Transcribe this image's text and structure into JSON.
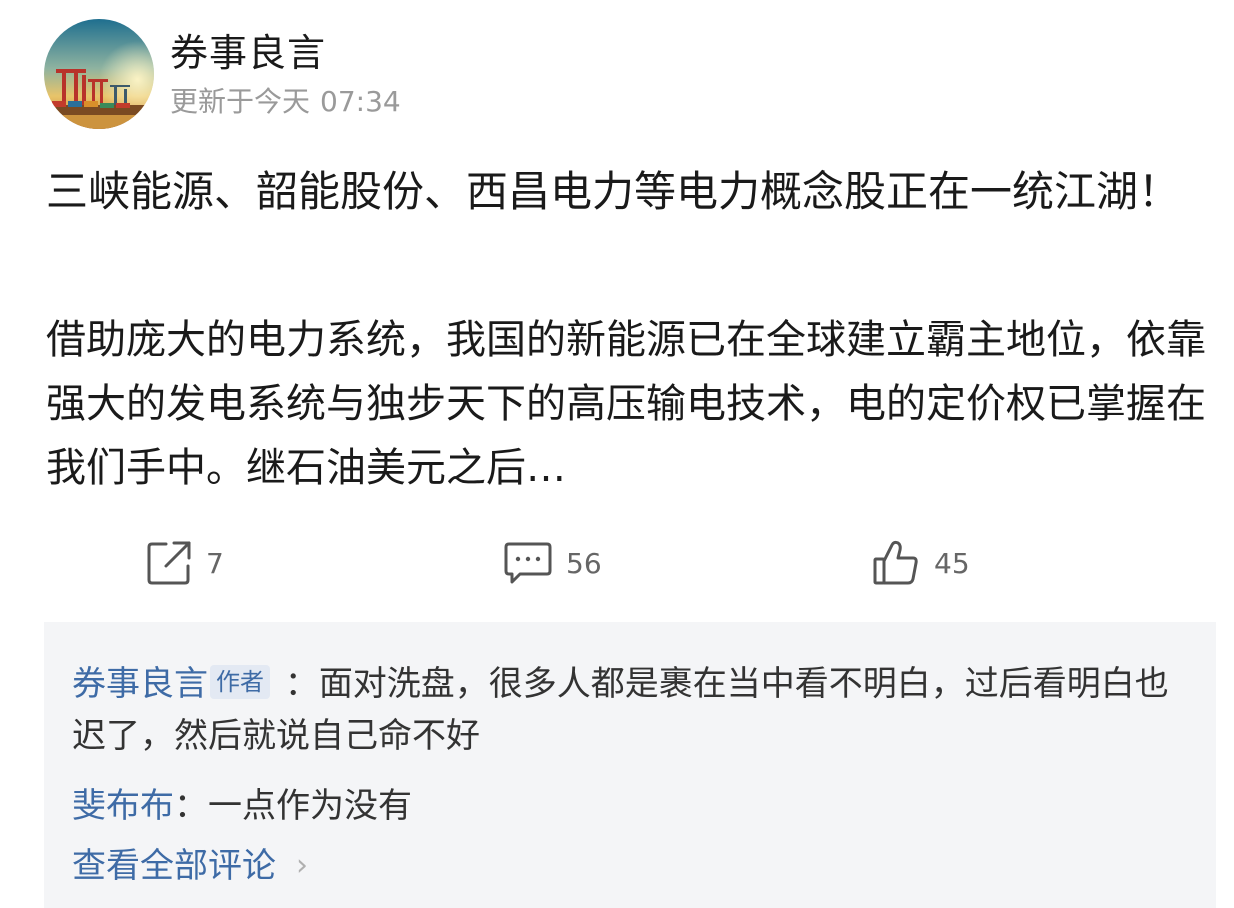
{
  "post": {
    "author_name": "券事良言",
    "update_label": "更新于今天",
    "update_time": "07:34",
    "title": "三峡能源、韶能股份、西昌电力等电力概念股正在一统江湖！",
    "body": "借助庞大的电力系统，我国的新能源已在全球建立霸主地位，依靠强大的发电系统与独步天下的高压输电技术，电的定价权已掌握在我们手中。继石油美元之后…"
  },
  "actions": {
    "share_count": "7",
    "comment_count": "56",
    "like_count": "45",
    "share_icon": "share-icon",
    "comment_icon": "comment-icon",
    "like_icon": "thumbs-up-icon"
  },
  "comments": [
    {
      "user": "券事良言",
      "badge": "作者",
      "separator": " ：",
      "text": "面对洗盘，很多人都是裹在当中看不明白，过后看明白也迟了，然后就说自己命不好"
    },
    {
      "user": "斐布布",
      "separator": "：",
      "text": "一点作为没有"
    }
  ],
  "view_all_label": "查看全部评论",
  "colors": {
    "link": "#3e6ba6",
    "comment_bg": "#f4f5f7",
    "muted": "#9a9a9a"
  }
}
